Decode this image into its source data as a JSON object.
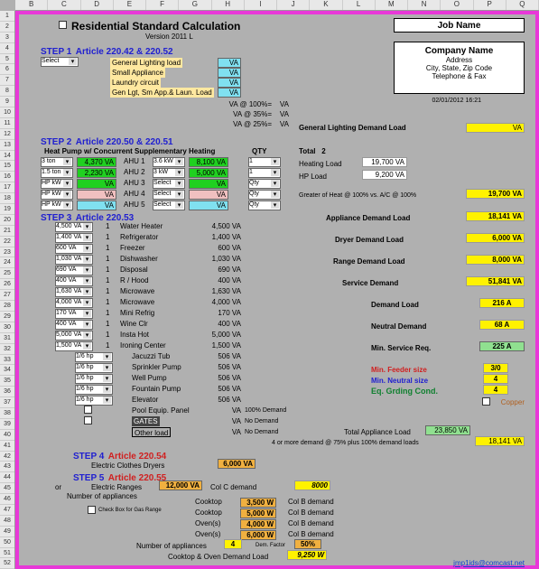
{
  "cols": [
    "B",
    "C",
    "D",
    "E",
    "F",
    "G",
    "H",
    "I",
    "J",
    "K",
    "L",
    "M",
    "N",
    "O",
    "P",
    "Q"
  ],
  "rows": [
    "1",
    "2",
    "3",
    "4",
    "5",
    "6",
    "7",
    "8",
    "9",
    "10",
    "11",
    "12",
    "13",
    "14",
    "15",
    "16",
    "17",
    "18",
    "19",
    "20",
    "21",
    "22",
    "23",
    "24",
    "25",
    "26",
    "27",
    "28",
    "29",
    "30",
    "31",
    "32",
    "33",
    "34",
    "35",
    "36",
    "37",
    "38",
    "39",
    "40",
    "41",
    "42",
    "43",
    "44",
    "45",
    "46",
    "47",
    "48",
    "49",
    "50",
    "51",
    "52"
  ],
  "title": "Residential Standard Calculation",
  "version": "Version 2011 L",
  "jobname": "Job Name",
  "company": {
    "name": "Company Name",
    "addr": "Address",
    "csz": "City, State, Zip Code",
    "tel": "Telephone & Fax"
  },
  "date": "02/01/2012 16:21",
  "step1": {
    "hdr": "STEP 1",
    "art": "Article 220.42 & 220.52",
    "sel": "Select",
    "r": [
      {
        "l": "General Lighting load",
        "u": "VA"
      },
      {
        "l": "Small Appliance",
        "u": "VA"
      },
      {
        "l": "Laundry circuit",
        "u": "VA"
      },
      {
        "l": "Gen Lgt, Sm App.& Laun. Load",
        "u": "VA"
      }
    ],
    "pcts": [
      {
        "l": "VA @ 100%=",
        "u": "VA"
      },
      {
        "l": "VA @  35%=",
        "u": "VA"
      },
      {
        "l": "VA @  25%=",
        "u": "VA"
      }
    ]
  },
  "gldl": {
    "lbl": "General Lighting Demand Load",
    "val": "VA"
  },
  "step2": {
    "hdr": "STEP 2",
    "art": "Article 220.50 & 220.51",
    "sub": "Heat Pump w/ Concurrent Supplementary Heating",
    "qty": "QTY",
    "rows": [
      {
        "s1": "3 ton",
        "v1": "4,370 VA",
        "ahu": "AHU 1",
        "s2": "3.6 kW",
        "v2": "8,100 VA",
        "q": "1",
        "c1": "g"
      },
      {
        "s1": "1.5 ton",
        "v1": "2,230 VA",
        "ahu": "AHU 2",
        "s2": "3 kW",
        "v2": "5,000 VA",
        "q": "1",
        "c1": "g"
      },
      {
        "s1": "HP kW",
        "v1": "VA",
        "ahu": "AHU 3",
        "s2": "Select",
        "v2": "VA",
        "q": "Qty",
        "c1": "g"
      },
      {
        "s1": "HP kW",
        "v1": "VA",
        "ahu": "AHU 4",
        "s2": "Select",
        "v2": "VA",
        "q": "Qty",
        "c1": "p"
      },
      {
        "s1": "HP kW",
        "v1": "VA",
        "ahu": "AHU 5",
        "s2": "Select",
        "v2": "VA",
        "q": "Qty",
        "c1": "b"
      }
    ],
    "total": "Total",
    "totalv": "2",
    "heat": {
      "l": "Heating Load",
      "v": "19,700 VA"
    },
    "hp": {
      "l": "HP Load",
      "v": "9,200 VA"
    },
    "greater": "Greater of Heat @ 100% vs. A/C @ 100%",
    "greaterv": "19,700 VA"
  },
  "step3": {
    "hdr": "STEP 3",
    "art": "Article 220.53",
    "items": [
      {
        "s": "4,500 VA",
        "q": "1",
        "n": "Water Heater",
        "v": "4,500 VA"
      },
      {
        "s": "1,400 VA",
        "q": "1",
        "n": "Refrigerator",
        "v": "1,400 VA"
      },
      {
        "s": "600 VA",
        "q": "1",
        "n": "Freezer",
        "v": "600 VA"
      },
      {
        "s": "1,030 VA",
        "q": "1",
        "n": "Dishwasher",
        "v": "1,030 VA"
      },
      {
        "s": "690 VA",
        "q": "1",
        "n": "Disposal",
        "v": "690 VA"
      },
      {
        "s": "400 VA",
        "q": "1",
        "n": "R / Hood",
        "v": "400 VA"
      },
      {
        "s": "1,630 VA",
        "q": "1",
        "n": "Microwave",
        "v": "1,630 VA"
      },
      {
        "s": "4,000 VA",
        "q": "1",
        "n": "Microwave",
        "v": "4,000 VA"
      },
      {
        "s": "170 VA",
        "q": "1",
        "n": "Mini Refrig",
        "v": "170 VA"
      },
      {
        "s": "400 VA",
        "q": "1",
        "n": "Wine Clr",
        "v": "400 VA"
      },
      {
        "s": "5,000 VA",
        "q": "1",
        "n": "Insta Hot",
        "v": "5,000 VA"
      },
      {
        "s": "1,500 VA",
        "q": "1",
        "n": "Ironing Center",
        "v": "1,500 VA"
      }
    ],
    "hp_items": [
      {
        "s": "1/6 hp",
        "n": "Jacuzzi Tub",
        "v": "506 VA"
      },
      {
        "s": "1/6 hp",
        "n": "Sprinkler Pump",
        "v": "506 VA"
      },
      {
        "s": "1/6 hp",
        "n": "Well Pump",
        "v": "506 VA"
      },
      {
        "s": "1/6 hp",
        "n": "Fountain Pump",
        "v": "506 VA"
      },
      {
        "s": "1/6 hp",
        "n": "Elevator",
        "v": "506 VA"
      }
    ],
    "pool": {
      "l": "Pool Equip. Panel",
      "v": "VA",
      "note": "100% Demand"
    },
    "gates": {
      "l": "GATES",
      "v": "VA",
      "note": "No Demand"
    },
    "other": {
      "l": "Other load",
      "v": "VA",
      "note": "No Demand"
    },
    "adl": {
      "l": "Appliance Demand Load",
      "v": "18,141 VA"
    },
    "ddl": {
      "l": "Dryer Demand Load",
      "v": "6,000 VA"
    },
    "rdl": {
      "l": "Range Demand Load",
      "v": "8,000 VA"
    },
    "sd": {
      "l": "Service Demand",
      "v": "51,841 VA"
    },
    "dl": {
      "l": "Demand Load",
      "v": "216 A"
    },
    "nd": {
      "l": "Neutral Demand",
      "v": "68 A"
    },
    "msr": {
      "l": "Min. Service Req.",
      "v": "225 A"
    },
    "mfs": {
      "l": "Min. Feeder size",
      "v": "3/0"
    },
    "mns": {
      "l": "Min. Neutral size",
      "v": "4"
    },
    "egc": {
      "l": "Eq. Grding Cond.",
      "v": "4"
    },
    "copper": "Copper",
    "tal": {
      "l": "Total Appliance Load",
      "v": "23,850 VA"
    },
    "note4": "4 or more demand @ 75% plus 100% demand loads",
    "note4v": "18,141 VA"
  },
  "step4": {
    "hdr": "STEP  4",
    "art": "Article 220.54",
    "l": "Electric Clothes Dryers",
    "v": "6,000 VA"
  },
  "step5": {
    "hdr": "STEP  5",
    "art": "Article 220.55",
    "l": "Electric Ranges",
    "v": "12,000 VA",
    "coc": "Col  C demand",
    "cocv": "8000",
    "or": "or",
    "num": "Number of appliances",
    "chk": "Check Box for Gas Range",
    "ovens": [
      {
        "n": "Cooktop",
        "v": "3,500 W",
        "c": "Col B demand"
      },
      {
        "n": "Cooktop",
        "v": "5,000 W",
        "c": "Col B demand"
      },
      {
        "n": "Oven(s)",
        "v": "4,000 W",
        "c": "Col B demand"
      },
      {
        "n": "Oven(s)",
        "v": "6,000 W",
        "c": "Col B demand"
      }
    ],
    "numapp": {
      "l": "Number of appliances",
      "v": "4",
      "df": "Dem. Factor",
      "dfv": "50%"
    },
    "codl": {
      "l": "Cooktop & Oven Demand Load",
      "v": "9,250 W"
    }
  },
  "email": "jmp1ids@comcast.net"
}
